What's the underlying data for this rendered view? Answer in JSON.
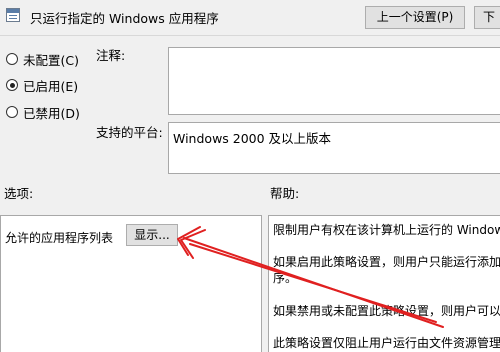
{
  "window": {
    "title": "只运行指定的 Windows 应用程序",
    "title_icon": "policy-setting-icon"
  },
  "toolbar": {
    "prev_label": "上一个设置(P)",
    "next_label": "下"
  },
  "state": {
    "options": [
      {
        "label": "未配置(C)",
        "checked": false
      },
      {
        "label": "已启用(E)",
        "checked": true
      },
      {
        "label": "已禁用(D)",
        "checked": false
      }
    ]
  },
  "comment": {
    "label": "注释:",
    "value": ""
  },
  "platform": {
    "label": "支持的平台:",
    "value": "Windows 2000 及以上版本"
  },
  "options_section": {
    "label": "选项:",
    "list_label": "允许的应用程序列表",
    "show_button": "显示..."
  },
  "help_section": {
    "label": "帮助:",
    "lines": [
      "限制用户有权在该计算机上运行的 Windows",
      "如果启用此策略设置，则用户只能运行添加到",
      "序。",
      "如果禁用或未配置此策略设置，则用户可以运",
      "此策略设置仅阻止用户运行由文件资源管理器"
    ]
  },
  "annotation": {
    "color": "#e02020"
  }
}
